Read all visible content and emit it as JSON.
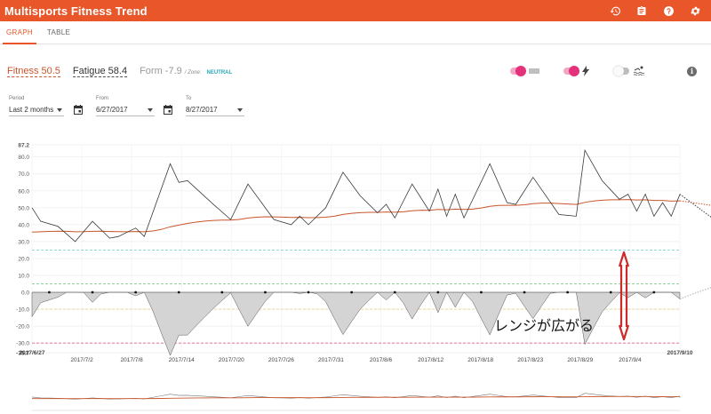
{
  "app": {
    "title": "Multisports Fitness Trend"
  },
  "tabs": [
    {
      "label": "GRAPH",
      "active": true
    },
    {
      "label": "TABLE",
      "active": false
    }
  ],
  "metrics": {
    "fitness_label": "Fitness 50.5",
    "fatigue_label": "Fatigue 58.4",
    "form_label": "Form -7.9",
    "zone_prefix": "/ Zone:",
    "zone_value": "NEUTRAL"
  },
  "toggles": [
    {
      "icon": "lines-icon",
      "on": true
    },
    {
      "icon": "lightning-icon",
      "on": true
    },
    {
      "icon": "swim-icon",
      "on": false
    }
  ],
  "filters": {
    "period_label": "Period",
    "period_value": "Last 2 months",
    "from_label": "From",
    "from_value": "6/27/2017",
    "to_label": "To",
    "to_value": "8/27/2017"
  },
  "colors": {
    "accent": "#e8562a",
    "fitness": "#c9552b",
    "fatigue": "#3a3a3a",
    "form_fill": "#d4d4d4",
    "zone_teal": "#84d1d6",
    "zone_green": "#8fd29a",
    "zone_yellow": "#e3d48a",
    "zone_red": "#e0668f",
    "annotation": "#cf2a2a"
  },
  "annotation": {
    "text": "レンジが広がる"
  },
  "chart_data": {
    "type": "line",
    "x_axis_labels": [
      "2017/6/27",
      "2017/7/2",
      "2017/7/8",
      "2017/7/14",
      "2017/7/20",
      "2017/7/26",
      "2017/7/31",
      "2017/8/6",
      "2017/8/12",
      "2017/8/18",
      "2017/8/23",
      "2017/8/29",
      "2017/9/4",
      "2017/9/10"
    ],
    "x_axis_bold": [
      "2017/6/27",
      "2017/9/10"
    ],
    "x_domain": [
      "2017-06-27",
      "2017-09-10"
    ],
    "ylim": [
      -35.7,
      87.2
    ],
    "y_ticks": [
      87.2,
      80.0,
      70.0,
      60.0,
      50.0,
      40.0,
      30.0,
      20.0,
      10.0,
      0.0,
      -10.0,
      -20.0,
      -30.0,
      -35.7
    ],
    "y_ticks_bold": [
      87.2,
      -35.7
    ],
    "zone_lines": [
      {
        "value": 25,
        "color": "#84d1d6"
      },
      {
        "value": 5,
        "color": "#8fd29a"
      },
      {
        "value": -10,
        "color": "#e3d48a"
      },
      {
        "value": -30,
        "color": "#e0668f"
      }
    ],
    "series": [
      {
        "name": "Fatigue",
        "color": "#3a3a3a",
        "points": [
          [
            "2017-06-27",
            50
          ],
          [
            "2017-06-28",
            42
          ],
          [
            "2017-06-30",
            39
          ],
          [
            "2017-07-02",
            30
          ],
          [
            "2017-07-04",
            42
          ],
          [
            "2017-07-06",
            32
          ],
          [
            "2017-07-07",
            33
          ],
          [
            "2017-07-09",
            38
          ],
          [
            "2017-07-10",
            33
          ],
          [
            "2017-07-13",
            76
          ],
          [
            "2017-07-14",
            65
          ],
          [
            "2017-07-15",
            66
          ],
          [
            "2017-07-18",
            52
          ],
          [
            "2017-07-20",
            43
          ],
          [
            "2017-07-22",
            64
          ],
          [
            "2017-07-25",
            43
          ],
          [
            "2017-07-27",
            40
          ],
          [
            "2017-07-28",
            45
          ],
          [
            "2017-07-29",
            40
          ],
          [
            "2017-07-31",
            50
          ],
          [
            "2017-08-02",
            71
          ],
          [
            "2017-08-04",
            57
          ],
          [
            "2017-08-06",
            47
          ],
          [
            "2017-08-07",
            52
          ],
          [
            "2017-08-08",
            44
          ],
          [
            "2017-08-10",
            64
          ],
          [
            "2017-08-12",
            48
          ],
          [
            "2017-08-13",
            61
          ],
          [
            "2017-08-14",
            45
          ],
          [
            "2017-08-15",
            58
          ],
          [
            "2017-08-16",
            44
          ],
          [
            "2017-08-19",
            76
          ],
          [
            "2017-08-21",
            53
          ],
          [
            "2017-08-22",
            52
          ],
          [
            "2017-08-24",
            68
          ],
          [
            "2017-08-27",
            46
          ],
          [
            "2017-08-29",
            45
          ],
          [
            "2017-08-30",
            84
          ],
          [
            "2017-09-01",
            66
          ],
          [
            "2017-09-03",
            55
          ],
          [
            "2017-09-04",
            58
          ],
          [
            "2017-09-05",
            48
          ],
          [
            "2017-09-06",
            58
          ],
          [
            "2017-09-07",
            45
          ],
          [
            "2017-09-08",
            53
          ],
          [
            "2017-09-09",
            45
          ],
          [
            "2017-09-10",
            58
          ]
        ],
        "projection": [
          [
            "2017-09-10",
            58
          ],
          [
            "2017-09-18",
            28
          ],
          [
            "2017-10-06",
            8
          ]
        ]
      }
    ]
  }
}
